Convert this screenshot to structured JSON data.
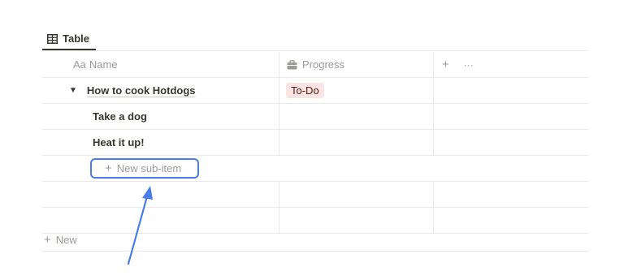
{
  "view_tab": {
    "label": "Table",
    "icon": "table-icon"
  },
  "columns": {
    "name": {
      "prefix": "Aa",
      "label": "Name"
    },
    "progress": {
      "label": "Progress",
      "icon": "briefcase-icon"
    },
    "add": {
      "plus": "+",
      "more": "···"
    }
  },
  "rows": [
    {
      "toggle": "▼",
      "name": "How to cook Hotdogs",
      "progress": "To-Do"
    },
    {
      "name": "Take a dog"
    },
    {
      "name": "Heat it up!"
    }
  ],
  "new_sub_item": {
    "plus": "+",
    "label": "New sub-item"
  },
  "new_row": {
    "plus": "+",
    "label": "New"
  },
  "colors": {
    "highlight": "#4a7ce8",
    "tag_bg": "#fbe4e4",
    "text": "#37352f",
    "muted": "#9b9a97"
  }
}
